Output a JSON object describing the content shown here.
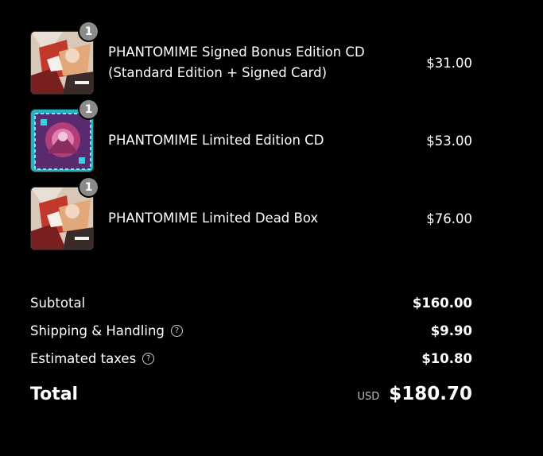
{
  "line_items": [
    {
      "name": "PHANTOMIME Signed Bonus Edition CD (Standard Edition + Signed Card)",
      "quantity": "1",
      "price": "$31.00",
      "thumbnail": "album-art-standard"
    },
    {
      "name": "PHANTOMIME Limited Edition CD",
      "quantity": "1",
      "price": "$53.00",
      "thumbnail": "album-art-limited"
    },
    {
      "name": "PHANTOMIME Limited Dead Box",
      "quantity": "1",
      "price": "$76.00",
      "thumbnail": "album-art-standard"
    }
  ],
  "summary": {
    "subtotal_label": "Subtotal",
    "subtotal_value": "$160.00",
    "shipping_label": "Shipping & Handling",
    "shipping_value": "$9.90",
    "taxes_label": "Estimated taxes",
    "taxes_value": "$10.80",
    "help_icon": "question-circle-icon",
    "help_glyph": "?"
  },
  "total": {
    "label": "Total",
    "currency": "USD",
    "value": "$180.70"
  },
  "colors": {
    "background": "#000000",
    "text": "#ffffff",
    "badge": "#8a8a8a",
    "muted": "#bfbfbf"
  }
}
